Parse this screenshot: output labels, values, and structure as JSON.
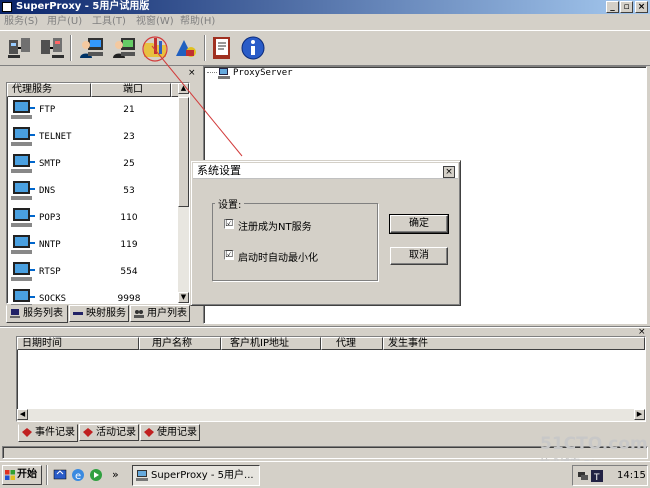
{
  "window": {
    "title": "SuperProxy - 5用户试用版",
    "minimize": "_",
    "restore": "▫",
    "close": "×"
  },
  "menu": [
    "服务(S)",
    "用户(U)",
    "工具(T)",
    "视窗(W)",
    "帮助(H)"
  ],
  "services": {
    "col_name": "代理服务",
    "col_port": "端口",
    "rows": [
      {
        "name": "FTP",
        "port": "21"
      },
      {
        "name": "TELNET",
        "port": "23"
      },
      {
        "name": "SMTP",
        "port": "25"
      },
      {
        "name": "DNS",
        "port": "53"
      },
      {
        "name": "POP3",
        "port": "110"
      },
      {
        "name": "NNTP",
        "port": "119"
      },
      {
        "name": "RTSP",
        "port": "554"
      },
      {
        "name": "SOCKS",
        "port": "9998"
      }
    ]
  },
  "left_tabs": [
    "服务列表",
    "映射服务",
    "用户列表"
  ],
  "tree": {
    "root": "ProxyServer"
  },
  "log": {
    "columns": [
      "日期时间",
      "用户名称",
      "客户机IP地址",
      "代理",
      "发生事件"
    ],
    "tabs": [
      "事件记录",
      "活动记录",
      "使用记录"
    ]
  },
  "dialog": {
    "title": "系统设置",
    "close": "×",
    "group_label": "设置:",
    "options": [
      {
        "label": "注册成为NT服务",
        "checked": true,
        "mark": "☑"
      },
      {
        "label": "启动时自动最小化",
        "checked": true,
        "mark": "☑"
      }
    ],
    "ok": "确定",
    "cancel": "取消"
  },
  "taskbar": {
    "start": "开始",
    "task": "SuperProxy - 5用户...",
    "time": "14:15",
    "chevron": "»"
  },
  "watermark": {
    "line1": "51CTO.com",
    "line2": "技术博客 Blog"
  },
  "colors": {
    "title_start": "#0a246a",
    "title_end": "#a6caf0",
    "annotation": "#d23c3c"
  }
}
